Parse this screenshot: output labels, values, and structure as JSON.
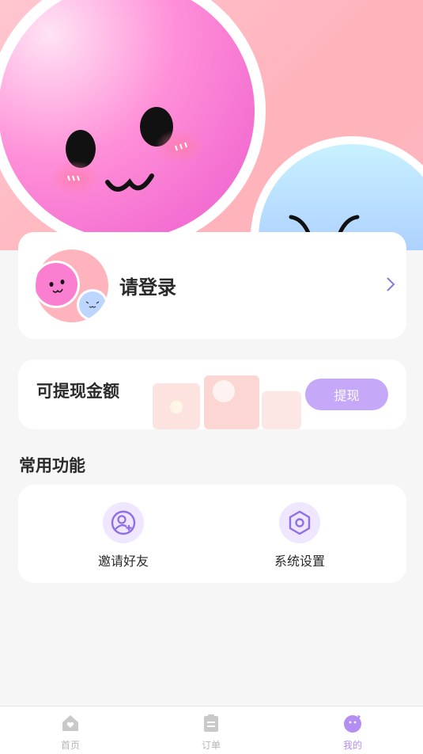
{
  "profile": {
    "login_prompt": "请登录"
  },
  "wallet": {
    "label": "可提现金额",
    "withdraw_button": "提现"
  },
  "features": {
    "title": "常用功能",
    "items": [
      {
        "label": "邀请好友",
        "icon": "invite-friend-icon"
      },
      {
        "label": "系统设置",
        "icon": "settings-icon"
      }
    ]
  },
  "tabbar": {
    "items": [
      {
        "label": "首页",
        "icon": "home-icon"
      },
      {
        "label": "订单",
        "icon": "order-icon"
      },
      {
        "label": "我的",
        "icon": "mine-icon",
        "active": true
      }
    ]
  },
  "colors": {
    "accent": "#c6a8f8",
    "active_tab": "#b58ef2",
    "background": "#f6f6f7"
  }
}
